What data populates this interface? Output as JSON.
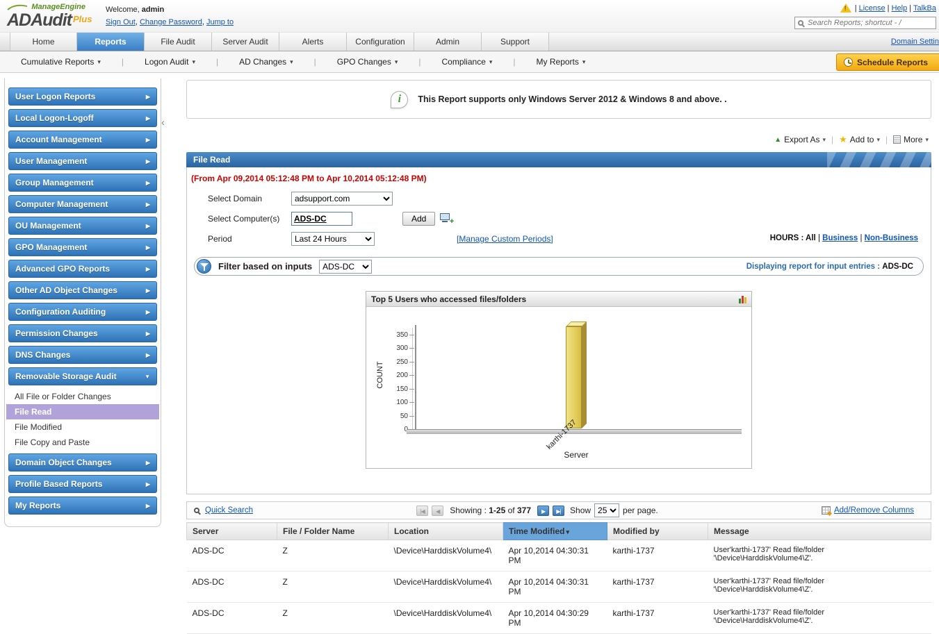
{
  "icons": {
    "caret_down": "▾",
    "chevron_right": "▶",
    "chevron_down": "▼",
    "first_page": "|◀",
    "prev_page": "◀",
    "next_page": "▶",
    "last_page": "▶|",
    "collapse": "‹",
    "star": "★",
    "export_arrow": "▲",
    "info": "i",
    "warning": "!",
    "pipe": "|"
  },
  "header": {
    "brand": "ManageEngine",
    "product": "ADAudit",
    "product_suffix": "Plus",
    "welcome_label": "Welcome,",
    "username": "admin",
    "session_links": [
      "Sign Out",
      "Change Password",
      "Jump to"
    ],
    "utility_links": [
      "License",
      "Help",
      "TalkBa"
    ],
    "search_placeholder": "Search Reports; shortcut - /"
  },
  "nav": {
    "tabs": [
      {
        "label": "Home",
        "active": false
      },
      {
        "label": "Reports",
        "active": true
      },
      {
        "label": "File Audit",
        "active": false
      },
      {
        "label": "Server Audit",
        "active": false
      },
      {
        "label": "Alerts",
        "active": false
      },
      {
        "label": "Configuration",
        "active": false
      },
      {
        "label": "Admin",
        "active": false
      },
      {
        "label": "Support",
        "active": false
      }
    ],
    "right_link": "Domain Settin"
  },
  "subnav": {
    "menus": [
      "Cumulative Reports",
      "Logon Audit",
      "AD Changes",
      "GPO Changes",
      "Compliance",
      "My Reports"
    ],
    "schedule_button": "Schedule Reports"
  },
  "sidebar": {
    "sections": [
      {
        "label": "User Logon Reports"
      },
      {
        "label": "Local Logon-Logoff"
      },
      {
        "label": "Account Management"
      },
      {
        "label": "User Management"
      },
      {
        "label": "Group Management"
      },
      {
        "label": "Computer Management"
      },
      {
        "label": "OU Management"
      },
      {
        "label": "GPO Management"
      },
      {
        "label": "Advanced GPO Reports"
      },
      {
        "label": "Other AD Object Changes"
      },
      {
        "label": "Configuration Auditing"
      },
      {
        "label": "Permission Changes"
      },
      {
        "label": "DNS Changes"
      },
      {
        "label": "Removable Storage Audit",
        "expanded": true,
        "children": [
          {
            "label": "All File or Folder Changes",
            "selected": false
          },
          {
            "label": "File Read",
            "selected": true
          },
          {
            "label": "File Modified",
            "selected": false
          },
          {
            "label": "File Copy and Paste",
            "selected": false
          }
        ]
      },
      {
        "label": "Domain Object Changes"
      },
      {
        "label": "Profile Based Reports"
      },
      {
        "label": "My Reports"
      }
    ]
  },
  "notice": {
    "text": "This Report supports only Windows Server 2012 & Windows 8 and above. ."
  },
  "actions": {
    "export_as": "Export As",
    "add_to": "Add to",
    "more": "More"
  },
  "report": {
    "title": "File Read",
    "date_range": "(From Apr 09,2014 05:12:48 PM to Apr 10,2014 05:12:48 PM)",
    "form": {
      "domain_label": "Select Domain",
      "domain_value": "adsupport.com",
      "computer_label": "Select Computer(s)",
      "computer_value": "ADS-DC",
      "add_button": "Add",
      "period_label": "Period",
      "period_value": "Last 24 Hours",
      "manage_periods_link": "[Manage Custom Periods]",
      "hours_label": "HOURS : All",
      "hours_links": [
        "Business",
        "Non-Business"
      ]
    },
    "filter": {
      "label": "Filter based on inputs",
      "value": "ADS-DC",
      "displaying_label": "Displaying report for input entries :",
      "displaying_value": "ADS-DC"
    }
  },
  "chart_data": {
    "type": "bar",
    "title": "Top 5 Users who accessed files/folders",
    "categories": [
      "karthi-1737"
    ],
    "values": [
      377
    ],
    "xlabel": "Server",
    "ylabel": "COUNT",
    "ylim": [
      0,
      385
    ],
    "yticks": [
      0,
      50,
      100,
      150,
      200,
      250,
      300,
      350
    ],
    "bar_color": "#e5d05e",
    "grid": false,
    "legend": "none"
  },
  "table": {
    "quick_search": "Quick Search",
    "showing_label": "Showing :",
    "showing_range": "1-25",
    "showing_of": "of",
    "showing_total": "377",
    "show_label": "Show",
    "page_size": "25",
    "per_page": "per page.",
    "add_remove_columns": "Add/Remove Columns",
    "columns": [
      "Server",
      "File / Folder Name",
      "Location",
      "Time Modified",
      "Modified by",
      "Message"
    ],
    "sorted_column": "Time Modified",
    "rows": [
      {
        "server": "ADS-DC",
        "file": "Z",
        "location": "\\Device\\HarddiskVolume4\\",
        "time": "Apr 10,2014 04:30:31 PM",
        "user": "karthi-1737",
        "message": "User'karthi-1737' Read file/folder '\\Device\\HarddiskVolume4\\Z'."
      },
      {
        "server": "ADS-DC",
        "file": "Z",
        "location": "\\Device\\HarddiskVolume4\\",
        "time": "Apr 10,2014 04:30:31 PM",
        "user": "karthi-1737",
        "message": "User'karthi-1737' Read file/folder '\\Device\\HarddiskVolume4\\Z'."
      },
      {
        "server": "ADS-DC",
        "file": "Z",
        "location": "\\Device\\HarddiskVolume4\\",
        "time": "Apr 10,2014 04:30:29 PM",
        "user": "karthi-1737",
        "message": "User'karthi-1737' Read file/folder '\\Device\\HarddiskVolume4\\Z'."
      }
    ]
  }
}
